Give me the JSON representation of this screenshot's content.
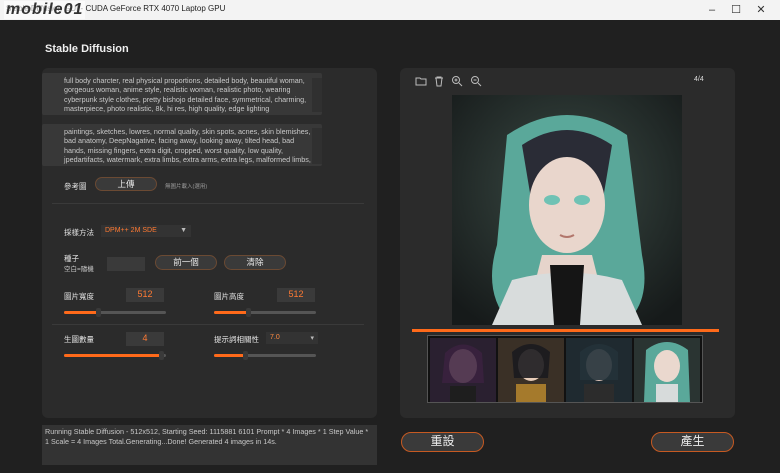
{
  "window": {
    "title": "Stable Diffusion GUI - CUDA  GeForce RTX 4070 Laptop GPU",
    "watermark": "mobile01",
    "controls": [
      "–",
      "☐",
      "✕"
    ]
  },
  "app": {
    "title": "Stable Diffusion"
  },
  "prompt": {
    "positive": "full body charcter, real physical proportions, detailed body, beautiful woman, gorgeous woman, anime style, realistic woman, realistic photo, wearing cyberpunk style clothes, pretty bishojo detailed face, symmetrical, charming, masterpiece, photo realistic, 8k, hi res, high quality, edge lighting",
    "negative": "paintings, sketches, lowres, normal quality, skin spots, acnes, skin blemishes, bad anatomy, DeepNagative, facing away, looking away, tilted head, bad hands, missing fingers, extra digit, cropped, worst quality, low quality, jpedartifacts, watermark, extra limbs, extra arms, extra legs, malformed limbs,"
  },
  "reference": {
    "label": "參考圖",
    "upload_label": "上傳",
    "hint": "無圖片載入(選用)"
  },
  "sampler": {
    "label": "採樣方法",
    "value": "DPM++ 2M SDE"
  },
  "seed": {
    "label": "種子",
    "sublabel": "空白=隨機",
    "prev_label": "前一個",
    "clear_label": "清除"
  },
  "width": {
    "label": "圖片寬度",
    "value": "512",
    "level": 0.33
  },
  "height": {
    "label": "圖片高度",
    "value": "512",
    "level": 0.33
  },
  "count": {
    "label": "生圖數量",
    "value": "4",
    "level": 0.95
  },
  "guidance": {
    "label": "提示詞相關性",
    "value": "7.0",
    "level": 0.3
  },
  "viewer": {
    "counter": "4/4",
    "progress": 1.0
  },
  "toolbar_icons": [
    "folder-icon",
    "trash-icon",
    "zoom-in-icon",
    "zoom-out-icon"
  ],
  "log": "Running Stable Diffusion - 512x512, Starting Seed: 1115881 6101 Prompt * 4 Images * 1 Step Value * 1 Scale = 4 Images Total.Generating...Done! Generated 4 images in 14s.",
  "actions": {
    "reset_label": "重設",
    "generate_label": "產生"
  },
  "colors": {
    "accent": "#ff6a1a",
    "background": "#202020",
    "panel": "#2b2b2b"
  }
}
